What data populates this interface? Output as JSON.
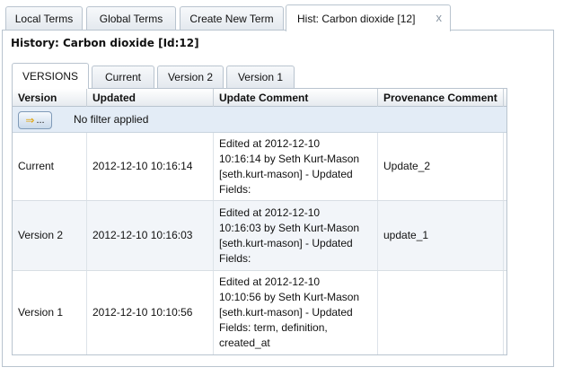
{
  "top_tabs": [
    {
      "label": "Local Terms"
    },
    {
      "label": "Global Terms"
    },
    {
      "label": "Create New Term"
    },
    {
      "label": "Hist: Carbon dioxide [12]",
      "close": "x"
    }
  ],
  "panel": {
    "title": "History: Carbon dioxide [Id:12]"
  },
  "inner_tabs": [
    {
      "label": "VERSIONS"
    },
    {
      "label": "Current"
    },
    {
      "label": "Version 2"
    },
    {
      "label": "Version 1"
    }
  ],
  "grid": {
    "columns": [
      "Version",
      "Updated",
      "Update Comment",
      "Provenance Comment"
    ],
    "filter": {
      "button_label": "...",
      "status": "No filter applied"
    },
    "rows": [
      {
        "version": "Current",
        "updated": "2012-12-10 10:16:14",
        "comment_lines": [
          "Edited at 2012-12-10",
          "10:16:14 by Seth Kurt-Mason",
          "[seth.kurt-mason] - Updated",
          "Fields:"
        ],
        "provenance": "Update_2"
      },
      {
        "version": "Version 2",
        "updated": "2012-12-10 10:16:03",
        "comment_lines": [
          "Edited at 2012-12-10",
          "10:16:03 by Seth Kurt-Mason",
          "[seth.kurt-mason] - Updated",
          "Fields:"
        ],
        "provenance": "update_1"
      },
      {
        "version": "Version 1",
        "updated": "2012-12-10 10:10:56",
        "comment_lines": [
          "Edited at 2012-12-10",
          "10:10:56 by Seth Kurt-Mason",
          "[seth.kurt-mason] - Updated",
          "Fields: term, definition,",
          "created_at"
        ],
        "provenance": ""
      }
    ]
  }
}
